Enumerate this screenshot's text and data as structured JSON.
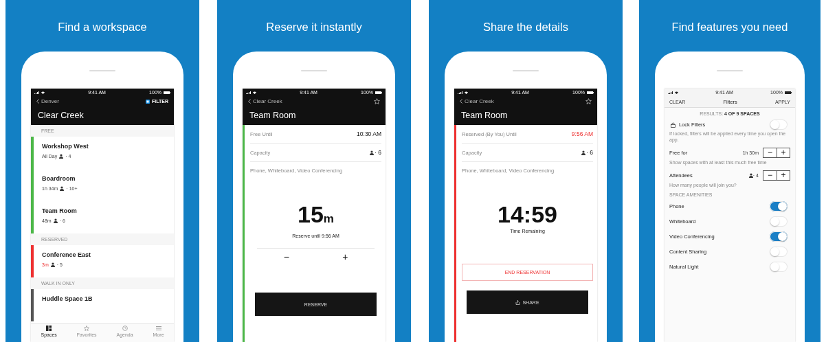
{
  "panels": [
    {
      "title": "Find a workspace",
      "screen": {
        "kind": "list",
        "status": {
          "time": "9:41 AM",
          "battery": "100%"
        },
        "dark": true,
        "back": "Denver",
        "action": "FILTER",
        "heading": "Clear Creek",
        "sections": [
          {
            "label": "FREE",
            "color": "#4cb748",
            "items": [
              {
                "name": "Workshop West",
                "time": "All Day",
                "capacity": "· 4",
                "alert": false
              },
              {
                "name": "Boardroom",
                "time": "1h 34m",
                "capacity": "· 10+",
                "alert": false
              },
              {
                "name": "Team Room",
                "time": "48m",
                "capacity": "· 6",
                "alert": false
              }
            ]
          },
          {
            "label": "RESERVED",
            "color": "#ee3030",
            "items": [
              {
                "name": "Conference East",
                "time": "3m",
                "capacity": "· 5",
                "alert": true
              }
            ]
          },
          {
            "label": "WALK IN ONLY",
            "color": "#555555",
            "items": [
              {
                "name": "Huddle Space 1B"
              }
            ]
          }
        ],
        "tabs": [
          {
            "label": "Spaces",
            "selected": true
          },
          {
            "label": "Favorites",
            "selected": false
          },
          {
            "label": "Agenda",
            "selected": false
          },
          {
            "label": "More",
            "selected": false
          }
        ]
      }
    },
    {
      "title": "Reserve it instantly",
      "screen": {
        "kind": "detail",
        "status": {
          "time": "9:41 AM",
          "battery": "100%"
        },
        "dark": true,
        "back": "Clear Creek",
        "heading": "Team Room",
        "color": "#4cb748",
        "rows": [
          {
            "kind": "text",
            "label": "Free Until",
            "value": "10:30 AM",
            "alert": false
          },
          {
            "kind": "capacity",
            "label": "Capacity",
            "value": "· 6"
          }
        ],
        "amenities": "Phone, Whiteboard, Video Conferencing",
        "big": "15",
        "unit": "m",
        "caption": "Reserve until 9:56 AM",
        "stepper": {
          "minus": "−",
          "plus": "+"
        },
        "buttons": [
          {
            "kind": "primary",
            "label": "RESERVE"
          }
        ]
      }
    },
    {
      "title": "Share the details",
      "screen": {
        "kind": "detail",
        "status": {
          "time": "9:41 AM",
          "battery": "100%"
        },
        "dark": true,
        "back": "Clear Creek",
        "heading": "Team Room",
        "color": "#ee3030",
        "rows": [
          {
            "kind": "text",
            "label": "Reserved (By You) Until",
            "value": "9:56 AM",
            "alert": true
          },
          {
            "kind": "capacity",
            "label": "Capacity",
            "value": "· 6"
          }
        ],
        "amenities": "Phone, Whiteboard, Video Conferencing",
        "big": "14:59",
        "caption": "Time Remaining",
        "buttons": [
          {
            "kind": "outline",
            "label": "END RESERVATION"
          },
          {
            "kind": "share",
            "label": "SHARE"
          }
        ]
      }
    },
    {
      "title": "Find features you need",
      "screen": {
        "kind": "filters",
        "status": {
          "time": "9:41 AM",
          "battery": "100%"
        },
        "dark": false,
        "clear": "CLEAR",
        "heading": "Filters",
        "apply": "APPLY",
        "results": "RESULTS: **4 OF 9 SPACES**",
        "lock": {
          "label": "Lock Filters",
          "on": false,
          "hint": "If locked, filters will be applied every time you open the app."
        },
        "steppers": [
          {
            "kind": "time",
            "label": "Free for",
            "value": "1h 30m",
            "minus": "−",
            "plus": "+",
            "hint": "Show spaces with at least this much free time"
          },
          {
            "kind": "capacity",
            "label": "Attendees",
            "value": "· 4",
            "minus": "−",
            "plus": "+",
            "hint": "How many people will join you?"
          }
        ],
        "section": "SPACE AMENITIES",
        "toggles": [
          {
            "label": "Phone",
            "on": true
          },
          {
            "label": "Whiteboard",
            "on": false
          },
          {
            "label": "Video Conferencing",
            "on": true
          },
          {
            "label": "Content Sharing",
            "on": false
          },
          {
            "label": "Natural Light",
            "on": false
          }
        ]
      }
    }
  ]
}
